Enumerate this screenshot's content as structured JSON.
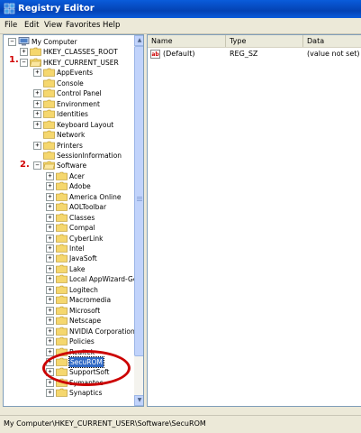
{
  "window": {
    "title": "Registry Editor"
  },
  "menu": [
    "File",
    "Edit",
    "View",
    "Favorites",
    "Help"
  ],
  "tree": {
    "root": "My Computer",
    "hives": [
      "HKEY_CLASSES_ROOT",
      "HKEY_CURRENT_USER"
    ],
    "hkcu_children": [
      "AppEvents",
      "Console",
      "Control Panel",
      "Environment",
      "Identities",
      "Keyboard Layout",
      "Network",
      "Printers",
      "SessionInformation",
      "Software"
    ],
    "software_children": [
      "Acer",
      "Adobe",
      "America Online",
      "AOLToolbar",
      "Classes",
      "Compal",
      "CyberLink",
      "Intel",
      "JavaSoft",
      "Lake",
      "Local AppWizard-Ge",
      "Logitech",
      "Macromedia",
      "Microsoft",
      "Netscape",
      "NVIDIA Corporation",
      "Policies",
      "Realtek",
      "SecuROM",
      "SupportSoft",
      "Symantec",
      "Synaptics"
    ],
    "selected": "SecuROM"
  },
  "list": {
    "columns": [
      "Name",
      "Type",
      "Data"
    ],
    "rows": [
      {
        "name": "(Default)",
        "type": "REG_SZ",
        "data": "(value not set)"
      }
    ]
  },
  "status": {
    "path": "My Computer\\HKEY_CURRENT_USER\\Software\\SecuROM"
  },
  "annotations": {
    "step1": "1.",
    "step2": "2."
  },
  "colors": {
    "title_bar": "#0a5cdb",
    "selection": "#316ac5",
    "annotation": "#cc0000",
    "folder": "#f5d76e"
  }
}
